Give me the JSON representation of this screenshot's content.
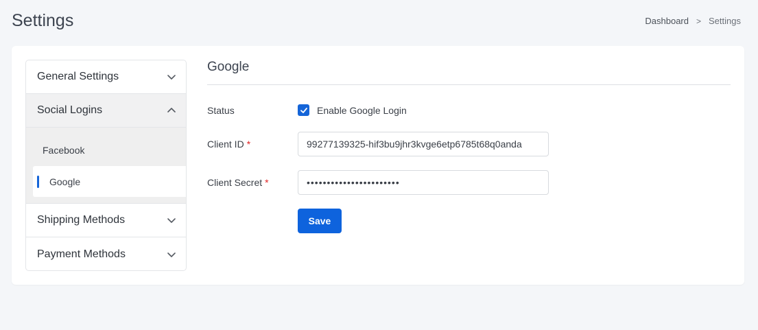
{
  "header": {
    "title": "Settings",
    "breadcrumb": {
      "home": "Dashboard",
      "separator": ">",
      "current": "Settings"
    }
  },
  "menu": {
    "general": {
      "label": "General Settings",
      "icon": "chevron-down-icon"
    },
    "social": {
      "label": "Social Logins",
      "icon": "chevron-up-icon"
    },
    "social_items": {
      "facebook": "Facebook",
      "google": "Google"
    },
    "shipping": {
      "label": "Shipping Methods",
      "icon": "chevron-down-icon"
    },
    "payment": {
      "label": "Payment Methods",
      "icon": "chevron-down-icon"
    }
  },
  "form": {
    "section_title": "Google",
    "status_label": "Status",
    "enable_label": "Enable Google Login",
    "enable_checked": true,
    "client_id_label": "Client ID",
    "client_id_value": "99277139325-hif3bu9jhr3kvge6etp6785t68q0anda",
    "client_secret_label": "Client Secret",
    "client_secret_value": "•••••••••••••••••••••••",
    "required_mark": "*",
    "save_label": "Save"
  },
  "colors": {
    "primary": "#0e63dd",
    "required": "#e02424",
    "background": "#f4f6f9"
  }
}
